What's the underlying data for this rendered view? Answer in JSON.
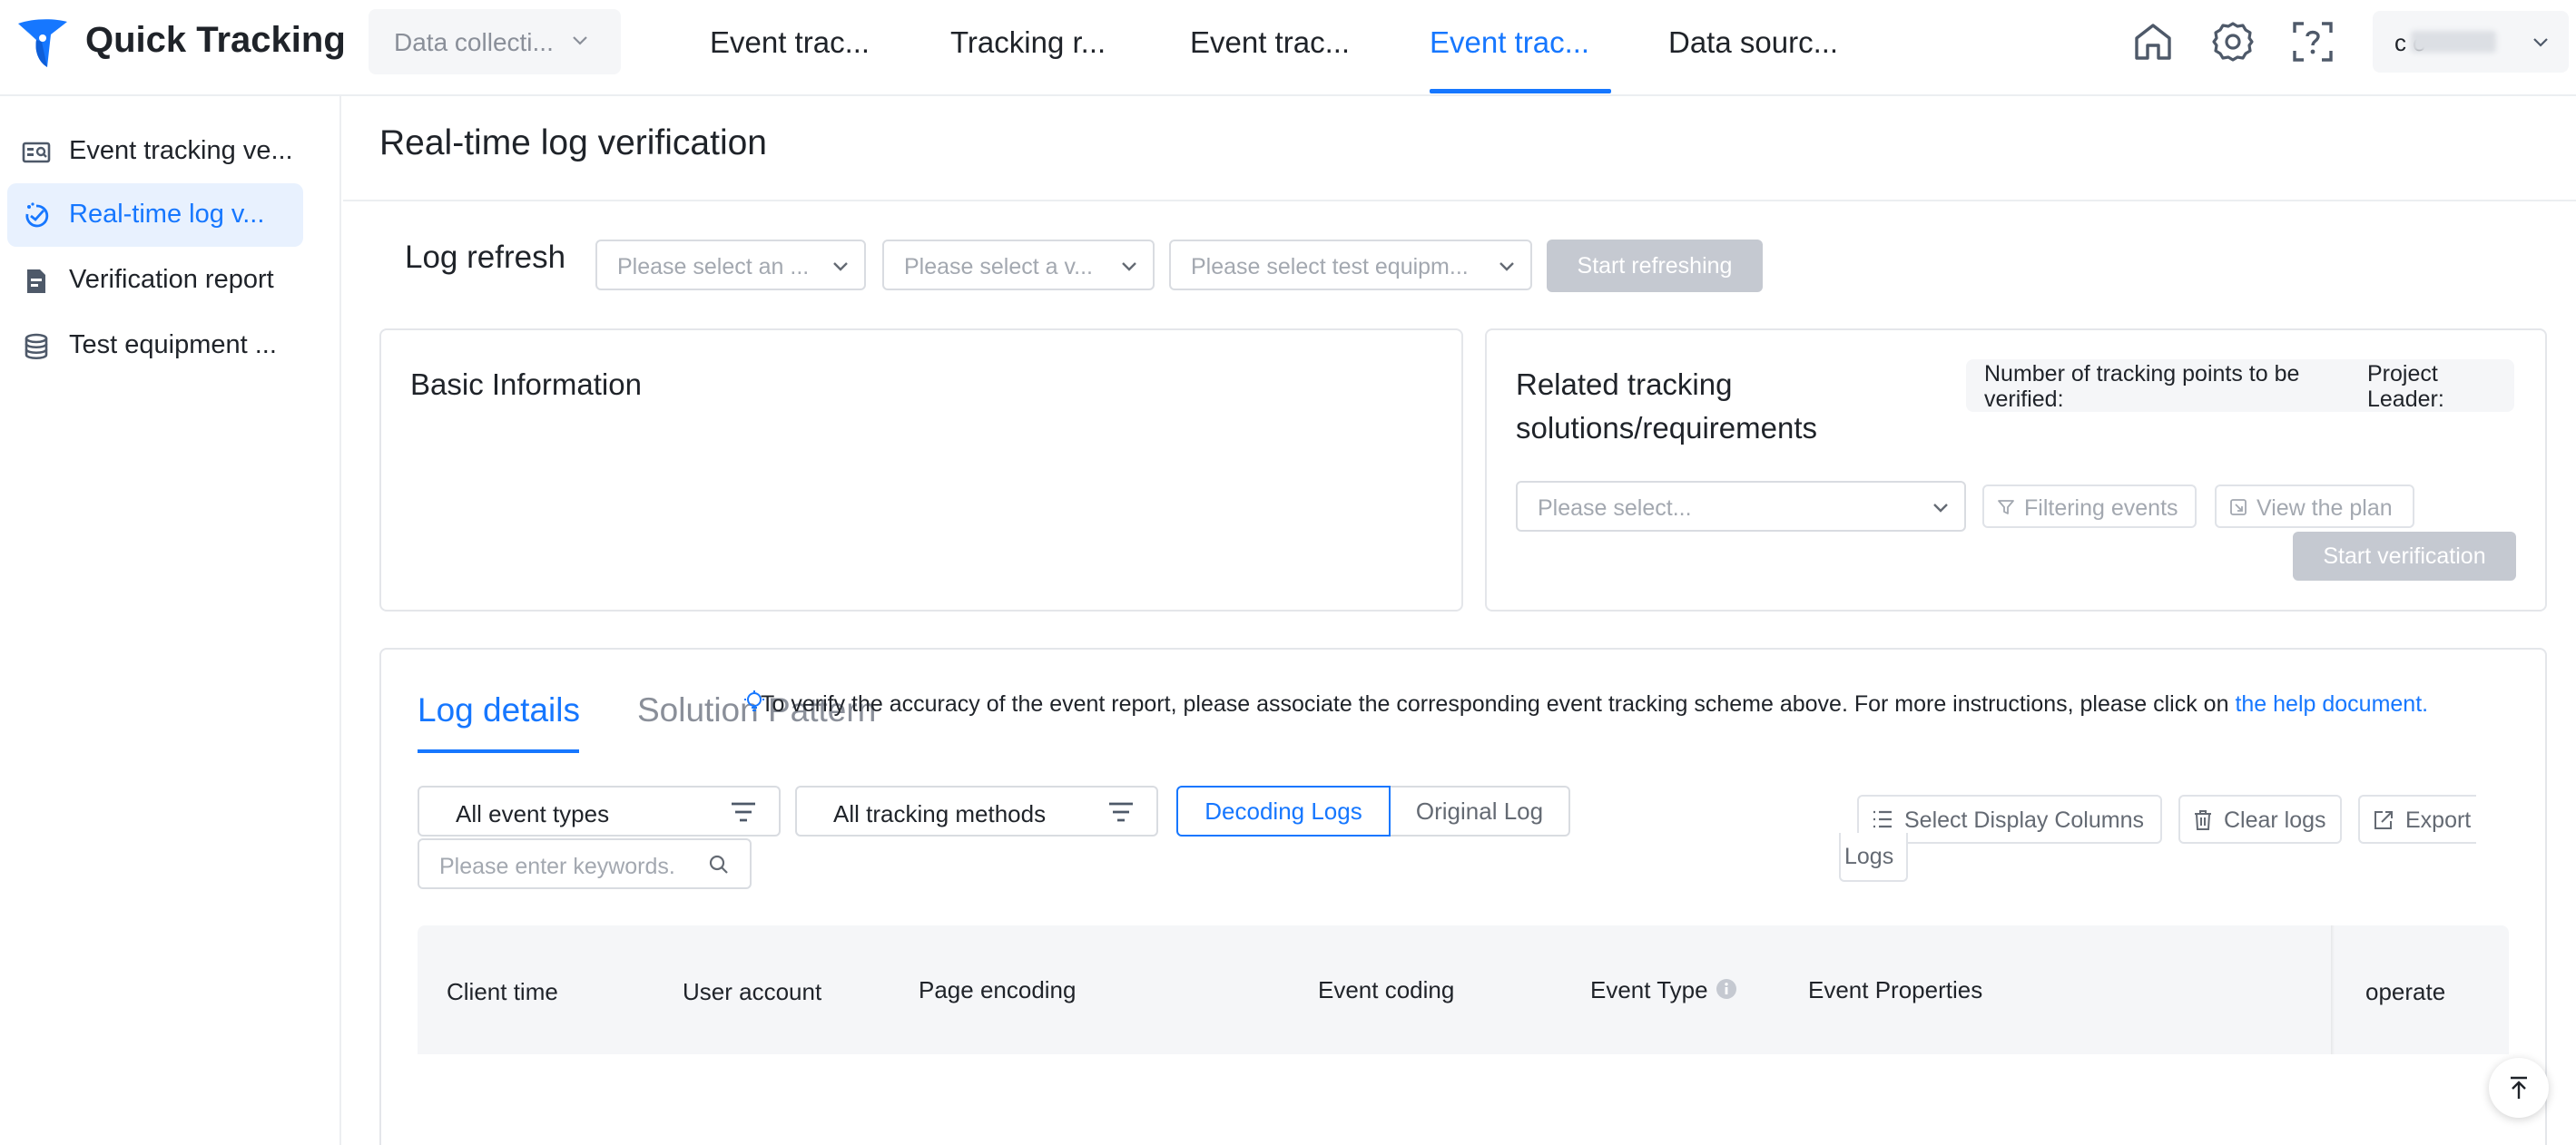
{
  "header": {
    "app_name": "Quick Tracking",
    "data_select": "Data collecti...",
    "nav_tabs": [
      {
        "label": "Event trac...",
        "active": false
      },
      {
        "label": "Tracking r...",
        "active": false
      },
      {
        "label": "Event trac...",
        "active": false
      },
      {
        "label": "Event trac...",
        "active": true
      },
      {
        "label": "Data sourc...",
        "active": false
      }
    ],
    "icons": [
      "home-icon",
      "gear-icon",
      "help-scan-icon"
    ],
    "user_name": "c          o"
  },
  "sidebar": {
    "items": [
      {
        "label": "Event tracking ve...",
        "icon": "id-card-search-icon",
        "active": false
      },
      {
        "label": "Real-time log v...",
        "icon": "pulse-check-icon",
        "active": true
      },
      {
        "label": "Verification report",
        "icon": "report-icon",
        "active": false
      },
      {
        "label": "Test equipment ...",
        "icon": "database-icon",
        "active": false
      }
    ]
  },
  "main": {
    "title": "Real-time log verification",
    "log_refresh": {
      "label": "Log refresh",
      "select_1_placeholder": "Please select an ...",
      "select_2_placeholder": "Please select a v...",
      "select_3_placeholder": "Please select test equipm...",
      "start_button": "Start refreshing"
    },
    "basic_info": {
      "title": "Basic Information"
    },
    "related": {
      "title_line1": "Related tracking",
      "title_line2": "solutions/requirements",
      "points_label_1": "Number of tracking points to be",
      "points_label_2": "verified:",
      "leader_label_1": "Project",
      "leader_label_2": "Leader:",
      "select_placeholder": "Please select...",
      "filter_button": "Filtering events",
      "view_button": "View the plan",
      "verify_button": "Start verification"
    },
    "logs": {
      "tabs": [
        {
          "label": "Log details",
          "active": true
        },
        {
          "label": "Solution Pattern",
          "active": false
        }
      ],
      "hint_text": "To verify the accuracy of the event report, please associate the corresponding event tracking scheme above. For more instructions, please click on",
      "hint_link": "the help document.",
      "event_type_filter": "All event types",
      "tracking_method_filter": "All tracking methods",
      "mode_decoding": "Decoding Logs",
      "mode_original": "Original Log",
      "select_columns": "Select Display Columns",
      "clear_logs": "Clear logs",
      "export_1": "Export",
      "export_2": "Logs",
      "search_placeholder": "Please enter keywords.",
      "columns": [
        "Client time",
        "User account",
        "Page encoding",
        "Event coding",
        "Event Type",
        "Event Properties",
        "operate"
      ]
    }
  },
  "colors": {
    "accent": "#1677ff",
    "disabled_button": "#c5c9d1",
    "header_bg": "#f5f6f8",
    "border": "#d9dce1"
  }
}
